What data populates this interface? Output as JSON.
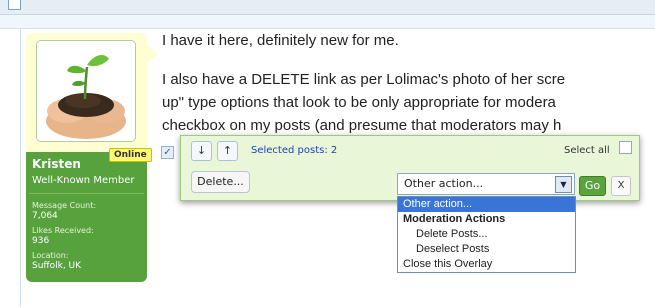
{
  "user": {
    "name": "Kristen",
    "title": "Well-Known Member",
    "online_badge": "Online",
    "stats": [
      {
        "label": "Message Count:",
        "value": "7,064"
      },
      {
        "label": "Likes Received:",
        "value": "936"
      },
      {
        "label": "Location:",
        "value": "Suffolk, UK"
      }
    ]
  },
  "message": {
    "line1": "I have it here, definitely new for me.",
    "line2": "I also have a DELETE link as per Lolimac's photo of her scre",
    "line3": "up\" type options that look to be only appropriate for modera",
    "line4": "checkbox on my posts (and presume that moderators may h"
  },
  "overlay": {
    "prev_icon": "↓",
    "next_icon": "↑",
    "selected_text": "Selected posts: 2",
    "select_all_label": "Select all",
    "delete_label": "Delete...",
    "action_select_value": "Other action...",
    "go_label": "Go",
    "close_label": "X"
  },
  "dropdown": {
    "options": [
      {
        "label": "Other action...",
        "kind": "selected"
      },
      {
        "label": "Moderation Actions",
        "kind": "group"
      },
      {
        "label": "Delete Posts...",
        "kind": "indented"
      },
      {
        "label": "Deselect Posts",
        "kind": "indented"
      },
      {
        "label": "Close this Overlay",
        "kind": "normal"
      }
    ]
  },
  "colors": {
    "user_panel_green": "#57a23d",
    "avatar_bg": "#fefed2",
    "overlay_bg": "#eaf6d8",
    "selected_option": "#3875d7",
    "link_blue": "#1c43b0"
  }
}
